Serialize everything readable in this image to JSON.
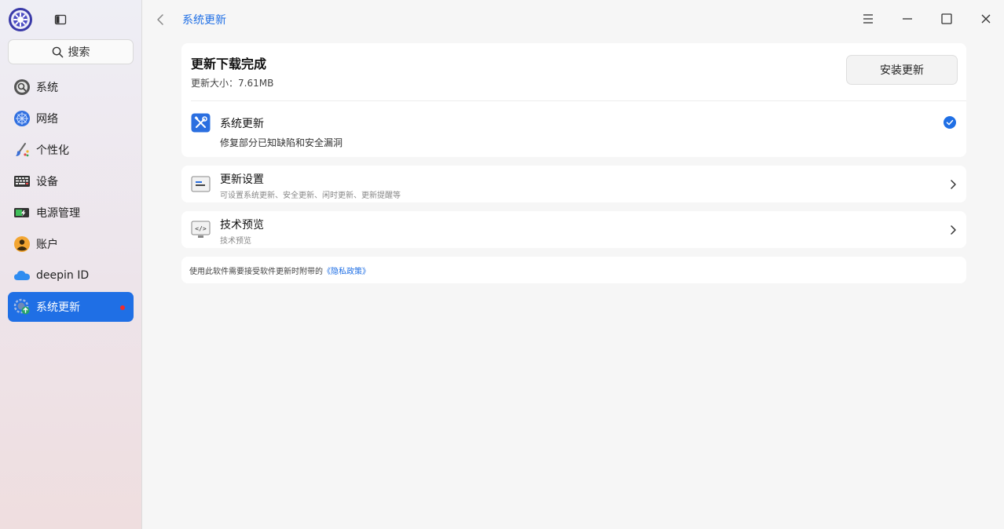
{
  "sidebar": {
    "search_label": "搜索",
    "items": [
      {
        "label": "系统",
        "icon": "system-icon"
      },
      {
        "label": "网络",
        "icon": "network-icon"
      },
      {
        "label": "个性化",
        "icon": "personalization-icon"
      },
      {
        "label": "设备",
        "icon": "device-icon"
      },
      {
        "label": "电源管理",
        "icon": "power-icon"
      },
      {
        "label": "账户",
        "icon": "account-icon"
      },
      {
        "label": "deepin ID",
        "icon": "deepin-id-icon"
      },
      {
        "label": "系统更新",
        "icon": "system-update-icon",
        "active": true,
        "badge": true
      }
    ]
  },
  "header": {
    "title": "系统更新"
  },
  "update_status": {
    "title": "更新下载完成",
    "size_text": "更新大小：7.61MB",
    "install_label": "安装更新",
    "item_name": "系统更新",
    "item_desc": "修复部分已知缺陷和安全漏洞"
  },
  "settings_rows": [
    {
      "name": "更新设置",
      "sub": "可设置系统更新、安全更新、闲时更新、更新提醒等"
    },
    {
      "name": "技术预览",
      "sub": "技术预览"
    }
  ],
  "footer": {
    "policy_text": "使用此软件需要接受软件更新时附带的",
    "policy_link": "《隐私政策》"
  },
  "colors": {
    "accent": "#1f6fe5",
    "badge": "#f02b2b"
  }
}
